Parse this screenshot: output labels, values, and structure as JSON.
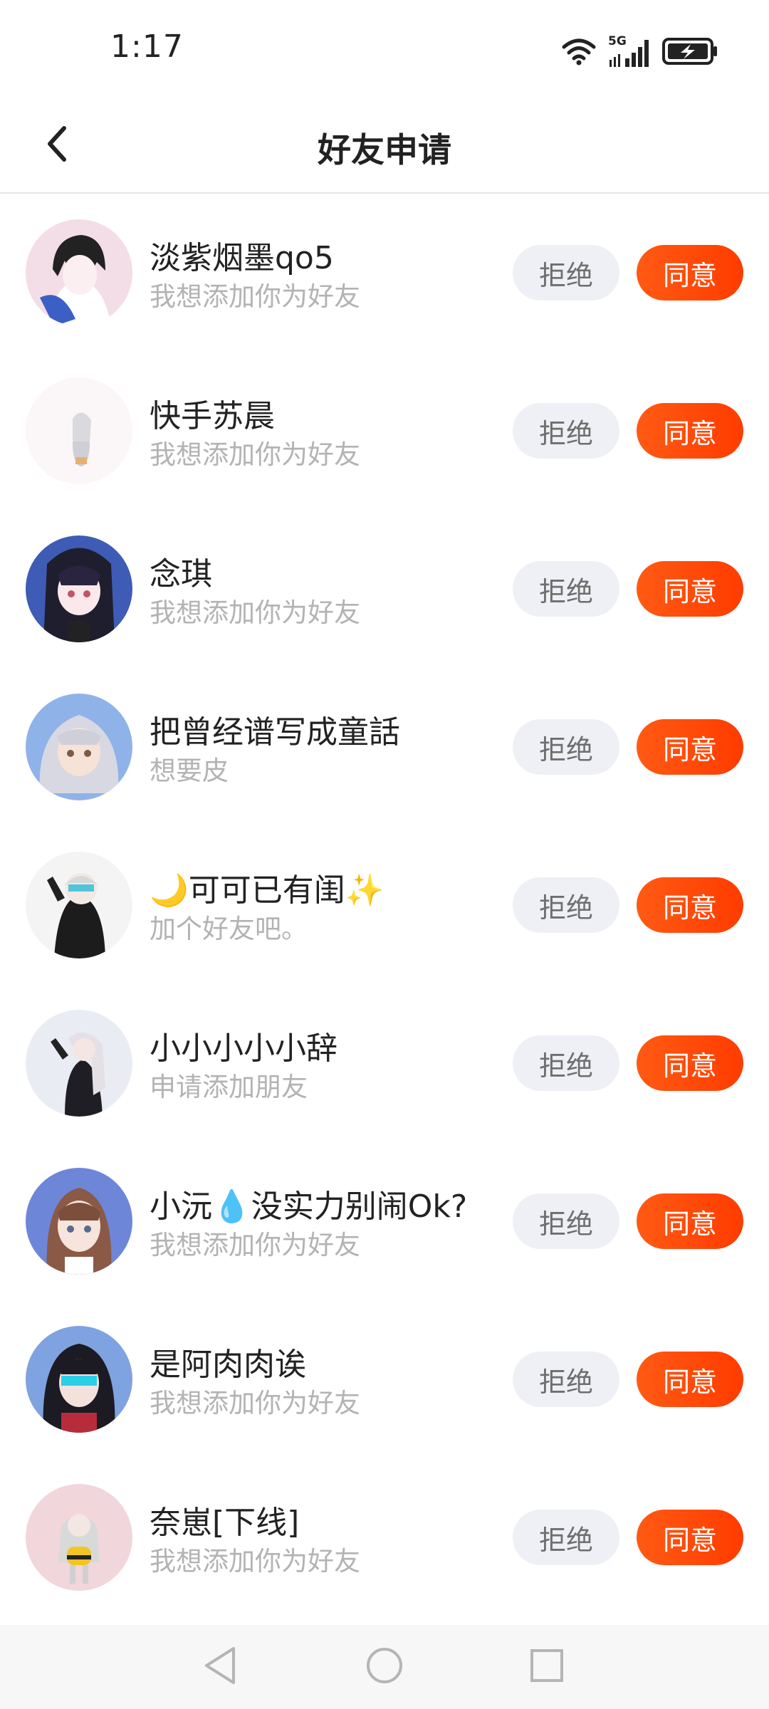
{
  "status_bar": {
    "time": "1:17",
    "network": "5G",
    "icons": [
      "wifi-icon",
      "signal-5g-icon",
      "battery-charging-icon"
    ]
  },
  "header": {
    "title": "好友申请",
    "back_icon": "chevron-left-icon"
  },
  "buttons": {
    "reject": "拒绝",
    "accept": "同意"
  },
  "colors": {
    "accept_gradient": [
      "#ff5a14",
      "#ff3c00"
    ],
    "reject_bg": "#eef0f5",
    "message_text": "#b3b3b3"
  },
  "requests": [
    {
      "name": "淡紫烟墨qo5",
      "message": "我想添加你为好友"
    },
    {
      "name": "快手苏晨",
      "message": "我想添加你为好友"
    },
    {
      "name": "念琪",
      "message": "我想添加你为好友"
    },
    {
      "name": "把曾经谱写成童話",
      "message": "想要皮"
    },
    {
      "name": "🌙可可已有闺✨",
      "message": "加个好友吧。"
    },
    {
      "name": "小小小小小辞",
      "message": "申请添加朋友"
    },
    {
      "name": "小沅💧没实力别闹Ok?",
      "message": "我想添加你为好友"
    },
    {
      "name": "是阿肉肉诶",
      "message": "我想添加你为好友"
    },
    {
      "name": "奈崽[下线]",
      "message": "我想添加你为好友"
    }
  ],
  "nav": {
    "icons": [
      "back-triangle-icon",
      "home-circle-icon",
      "recents-square-icon"
    ]
  }
}
